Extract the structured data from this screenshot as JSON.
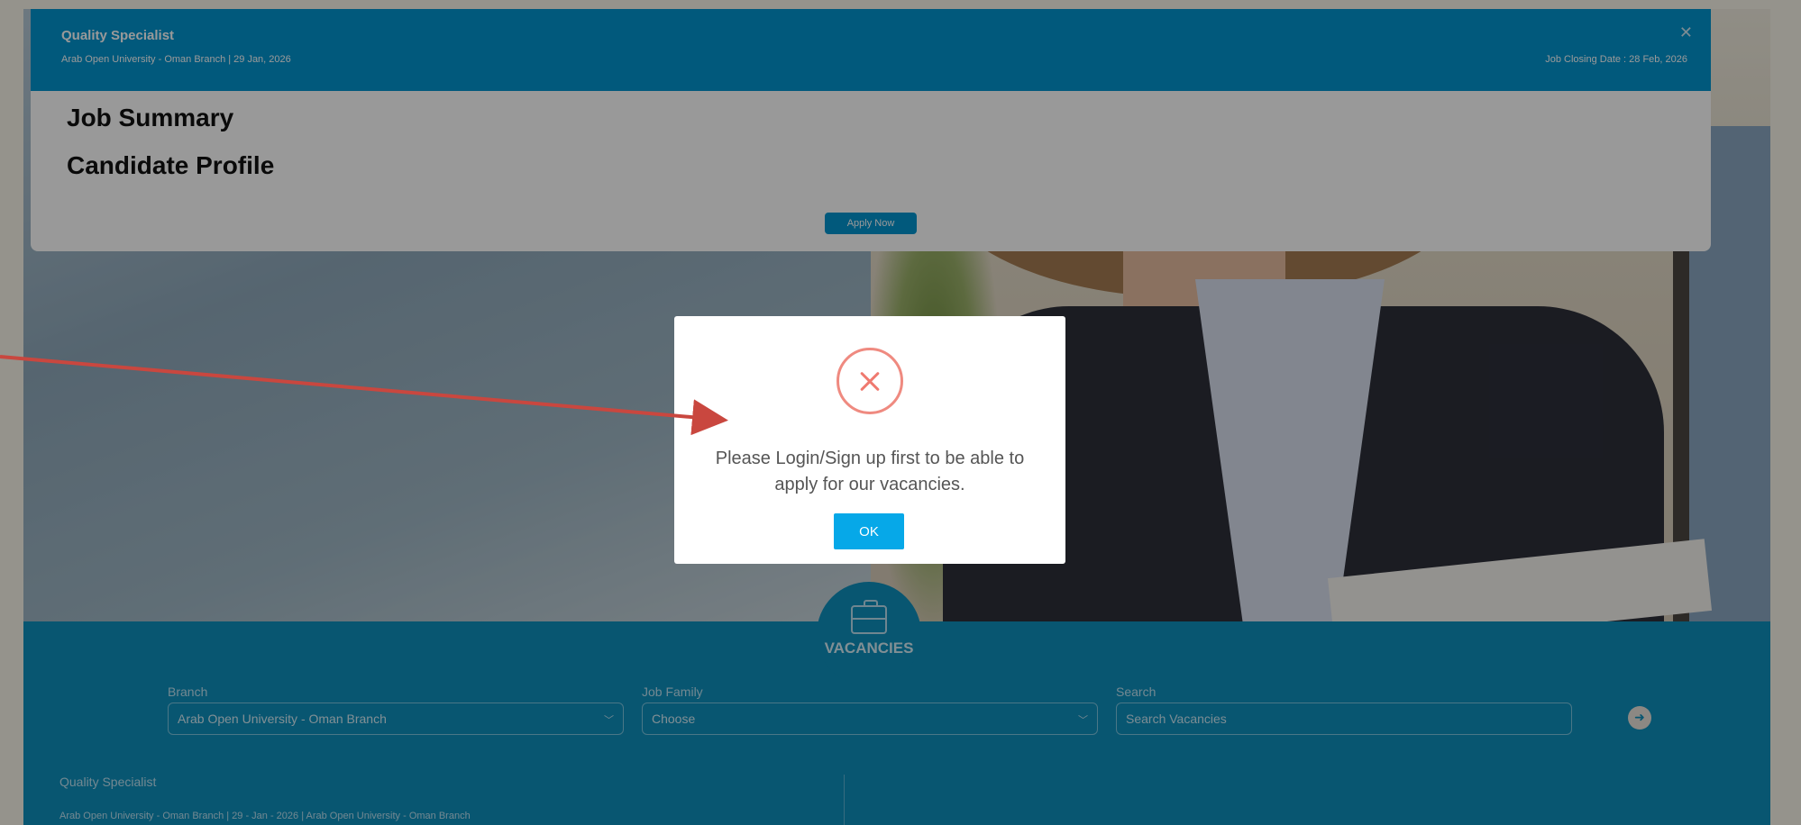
{
  "job_panel": {
    "title": "Quality Specialist",
    "subtitle": "Arab Open University - Oman Branch | 29 Jan, 2026",
    "closing_date": "Job Closing Date :  28 Feb, 2026",
    "close_icon": "close-icon",
    "sections": [
      "Job Summary",
      "Candidate Profile"
    ],
    "apply_label": "Apply Now"
  },
  "modal": {
    "icon": "error-x-icon",
    "message": "Please Login/Sign up first to be able to apply for our vacancies.",
    "ok_label": "OK"
  },
  "vacancies": {
    "icon": "briefcase-icon",
    "title": "VACANCIES",
    "branch_label": "Branch",
    "branch_value": "Arab Open University - Oman Branch",
    "family_label": "Job Family",
    "family_value": "Choose",
    "search_label": "Search",
    "search_placeholder": "Search Vacancies",
    "search_button_icon": "arrow-right-icon",
    "list": [
      {
        "title": "Quality Specialist",
        "meta": "Arab Open University - Oman Branch  |  29 - Jan - 2026 | Arab Open University - Oman Branch"
      }
    ]
  },
  "colors": {
    "header_blue": "#0394cf",
    "ok_button": "#06a8e8",
    "error_icon": "#ef8a80",
    "annotation_arrow": "#c9473f"
  }
}
